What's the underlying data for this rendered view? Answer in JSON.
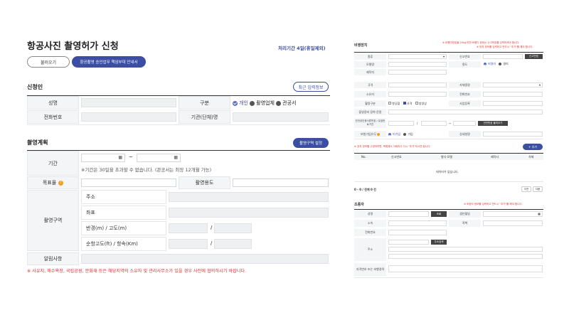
{
  "left": {
    "title": "항공사진 촬영허가 신청",
    "processing_period": "처리기간 4일(휴일제외)",
    "load_button": "불러오기",
    "military_button": "항공촬영 승인업무 책임부대 안내서",
    "applicant": {
      "section_title": "신청인",
      "recent_button": "최근 입력정보",
      "name_label": "성명",
      "type_label": "구분",
      "type_options": [
        "개인",
        "촬영업체",
        "관공서"
      ],
      "type_selected": "개인",
      "phone_label": "전화번호",
      "org_label": "기관(단체)명"
    },
    "plan": {
      "section_title": "촬영계획",
      "area_button": "촬영구역 설정",
      "period_label": "기간",
      "date_sep": "~",
      "period_note": "※기간은 30일을 초과할 수 없습니다. (관공서는 최장 12개월 가능)",
      "target_label": "목표물",
      "purpose_label": "촬영용도",
      "zone_label": "촬영구역",
      "address_label": "주소",
      "coord_label": "좌표",
      "radius_label": "반경(m) / 고도(m)",
      "altitude_label": "순항고도(ft) / 항속(Km)",
      "slash": "/",
      "notice_label": "알림사항",
      "warning": "※ 사유지, 해수욕장, 국립공원, 문화재 등은 해당지역의 소유자 및 관리사무소가 있을 경우 사전에 협의하시기 바랍니다."
    }
  },
  "right": {
    "aircraft": {
      "section_title": "비행장치",
      "note1": "※ 비행여부효율 25kg 미만 비행기 등등는 신고번호를 입력하셔야 합니다.",
      "note2": "※ 장치 정보를 입력하고 반드시 \"추가\"를 해야 합니다.",
      "type_label": "종류",
      "reg_label": "신고번호",
      "reg_button": "신고번호",
      "model_label": "모델명",
      "use_label": "용도",
      "use_options": [
        "비영리",
        "영리"
      ],
      "maker_label": "제작자",
      "spec_label": "규격",
      "weight_label": "자체중량",
      "owner_label": "소유자",
      "tel_label": "전화번호",
      "usage_label": "활용구분",
      "usage_options": [
        "항공촬",
        "사격",
        "방영상"
      ],
      "company_label": "사업등록",
      "loc_label": "촬영장비 장착·운용",
      "insurance_label": "안전성인증서류번호 / 유효만료기간",
      "insurance_button": "안전번호 불러오기",
      "insured_label": "보험가입유무",
      "insured_options": [
        "미가입",
        "가입"
      ],
      "detail_label": "상세설명",
      "add_note": "※ 장치 정보를 수정하려면, 목록에서 삭제하고 다시 \"추가\"하시면 됩니다.",
      "add_button": "+ 추가",
      "table_headers": [
        "No.",
        "신고번호",
        "형식·모델",
        "제작사",
        "삭제"
      ],
      "empty_text": "데이터가 없습니다.",
      "paging": "0 - 0 / 전체 0 건",
      "prev": "이전",
      "next": "다음"
    },
    "operator": {
      "section_title": "조종자",
      "note": "※ 조종자 정보를 입력하고 반드시 \"추가\"를 해야 합니다.",
      "name_label": "성명",
      "search_button": "조회",
      "birth_label": "생년월일",
      "org_label": "소속",
      "position_label": "직책",
      "phone_label": "전화번호",
      "address_label": "주소",
      "address_button": "주소검색",
      "license_label": "자격번호 또는 비행경력"
    }
  }
}
